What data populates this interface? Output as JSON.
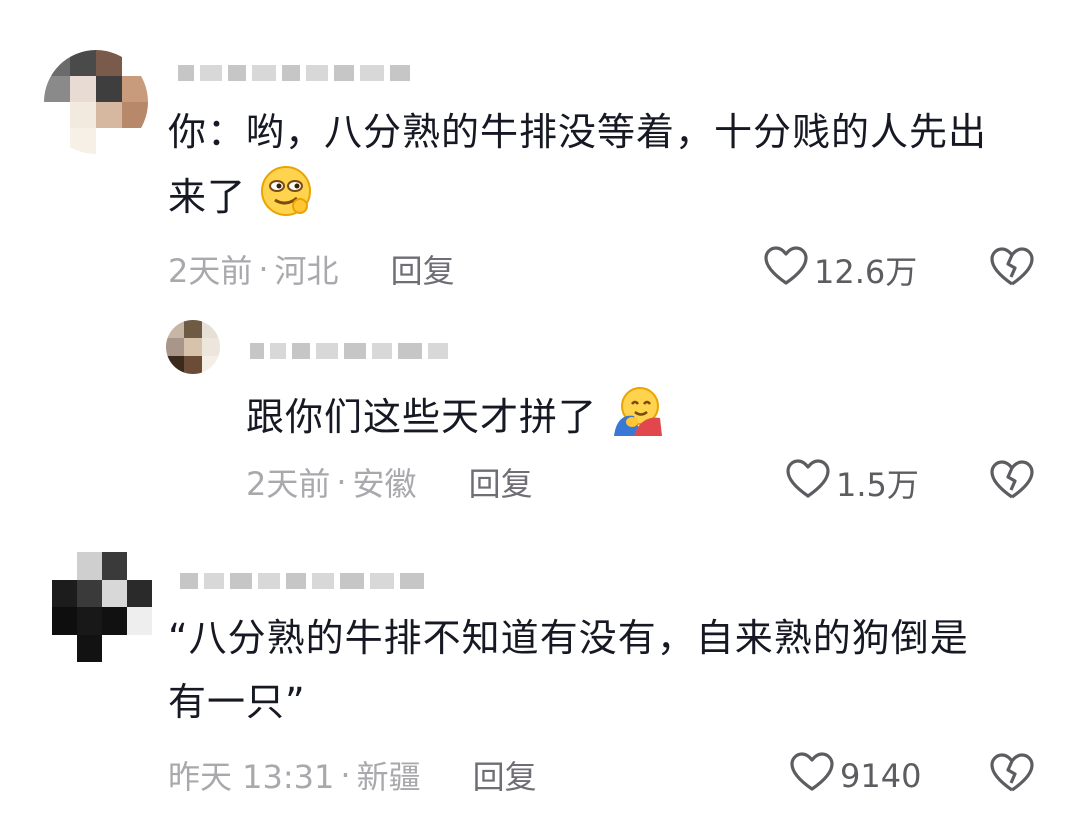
{
  "comments": [
    {
      "text_line1": "你：哟，八分熟的牛排没等着，十分贱的人先出",
      "text_line2": "来了",
      "emoji": "smirk-face-emoji",
      "time": "2天前",
      "location": "河北",
      "reply_label": "回复",
      "like_count": "12.6万",
      "replies": [
        {
          "text": "跟你们这些天才拼了",
          "emoji": "hugging-face-emoji",
          "time": "2天前",
          "location": "安徽",
          "reply_label": "回复",
          "like_count": "1.5万"
        }
      ]
    },
    {
      "text_line1": "“八分熟的牛排不知道有没有，自来熟的狗倒是",
      "text_line2": "有一只”",
      "time": "昨天 13:31",
      "location": "新疆",
      "reply_label": "回复",
      "like_count": "9140"
    }
  ],
  "separator": "·",
  "colors": {
    "text": "#161823",
    "meta": "#a9a9ad",
    "reply": "#6e6e74",
    "icon": "#5c5c61"
  }
}
